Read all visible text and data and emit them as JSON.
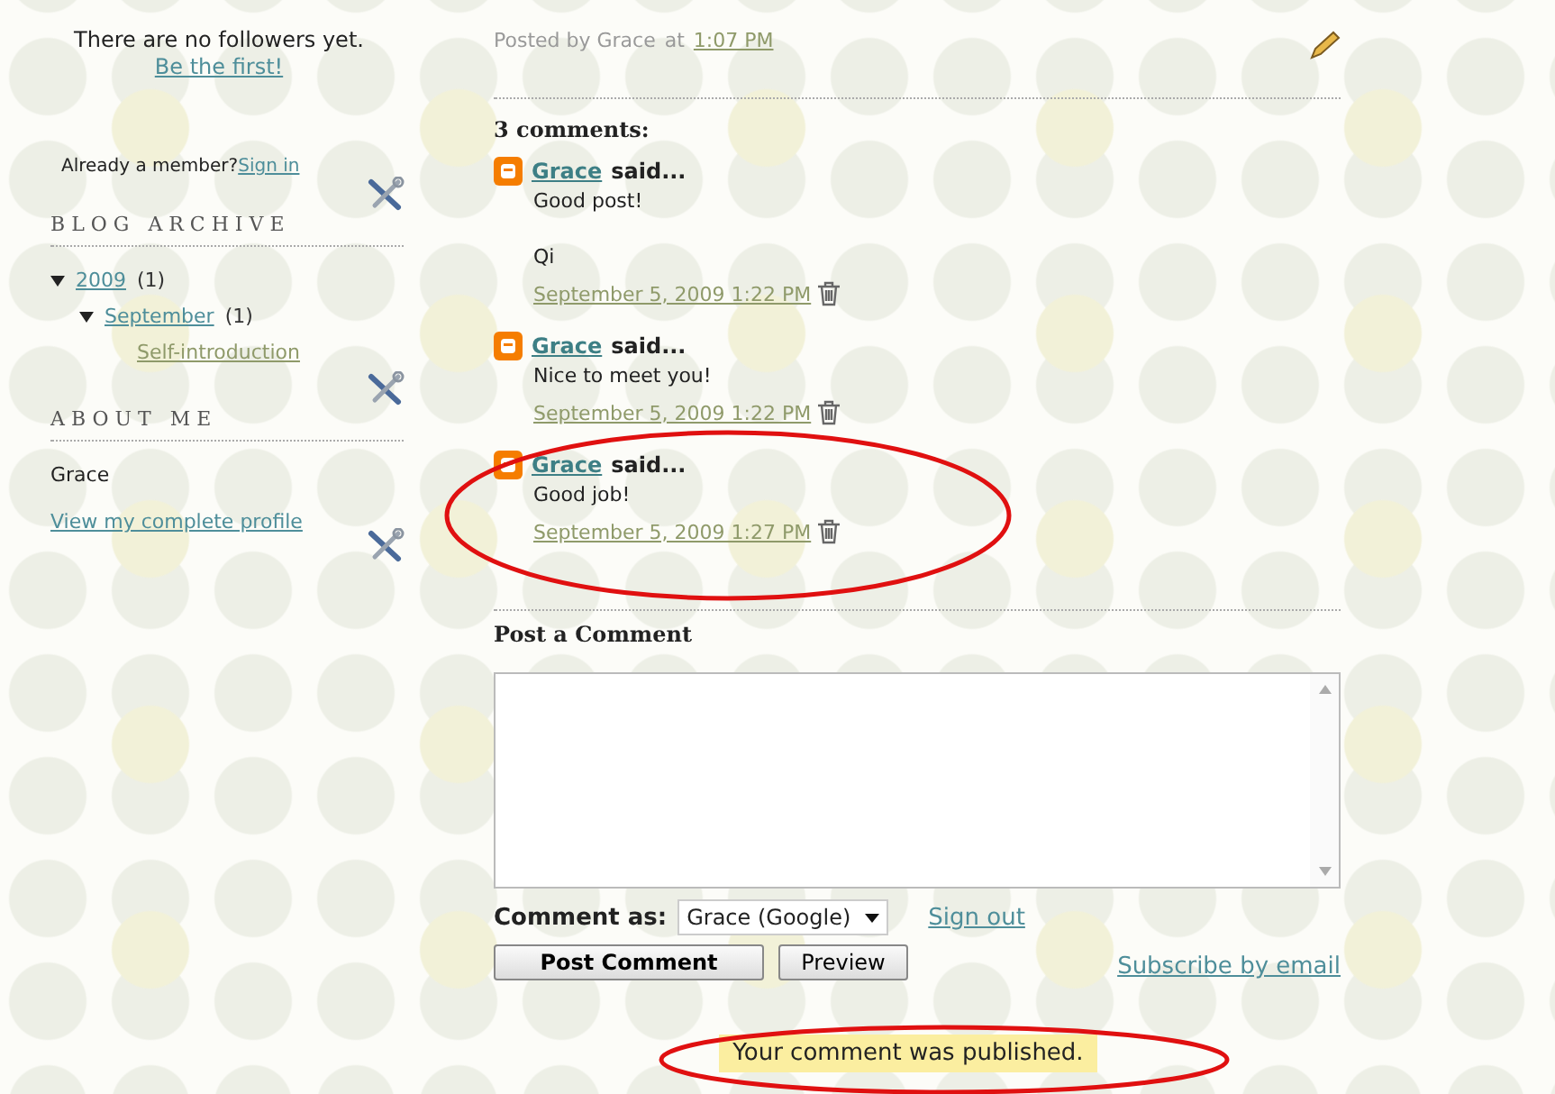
{
  "sidebar": {
    "followers": {
      "text": "There are no followers yet.",
      "link": "Be the first!"
    },
    "member": {
      "text": "Already a member?",
      "link": "Sign in"
    },
    "archive": {
      "title": "BLOG ARCHIVE",
      "items": [
        {
          "label": "2009",
          "count": "(1)",
          "expanded": true,
          "children": [
            {
              "label": "September",
              "count": "(1)",
              "expanded": true,
              "children": [
                {
                  "label": "Self-introduction"
                }
              ]
            }
          ]
        }
      ]
    },
    "about": {
      "title": "ABOUT ME",
      "name": "Grace",
      "link": "View my complete profile"
    }
  },
  "post_footer": {
    "posted_by": "Posted by Grace",
    "at": "at",
    "time": "1:07 PM"
  },
  "comments_heading": "3 comments:",
  "comments": [
    {
      "author": "Grace",
      "said": "said...",
      "paragraphs": [
        "Good post!",
        "Qi"
      ],
      "timestamp": "September 5, 2009 1:22 PM"
    },
    {
      "author": "Grace",
      "said": "said...",
      "paragraphs": [
        "Nice to meet you!"
      ],
      "timestamp": "September 5, 2009 1:22 PM"
    },
    {
      "author": "Grace",
      "said": "said...",
      "paragraphs": [
        "Good job!"
      ],
      "timestamp": "September 5, 2009 1:27 PM"
    }
  ],
  "form": {
    "title": "Post a Comment",
    "comment_as": "Comment as:",
    "identity": "Grace (Google)",
    "sign_out": "Sign out",
    "post_button": "Post Comment",
    "preview_button": "Preview",
    "subscribe": "Subscribe by email",
    "notice": "Your comment was published."
  }
}
